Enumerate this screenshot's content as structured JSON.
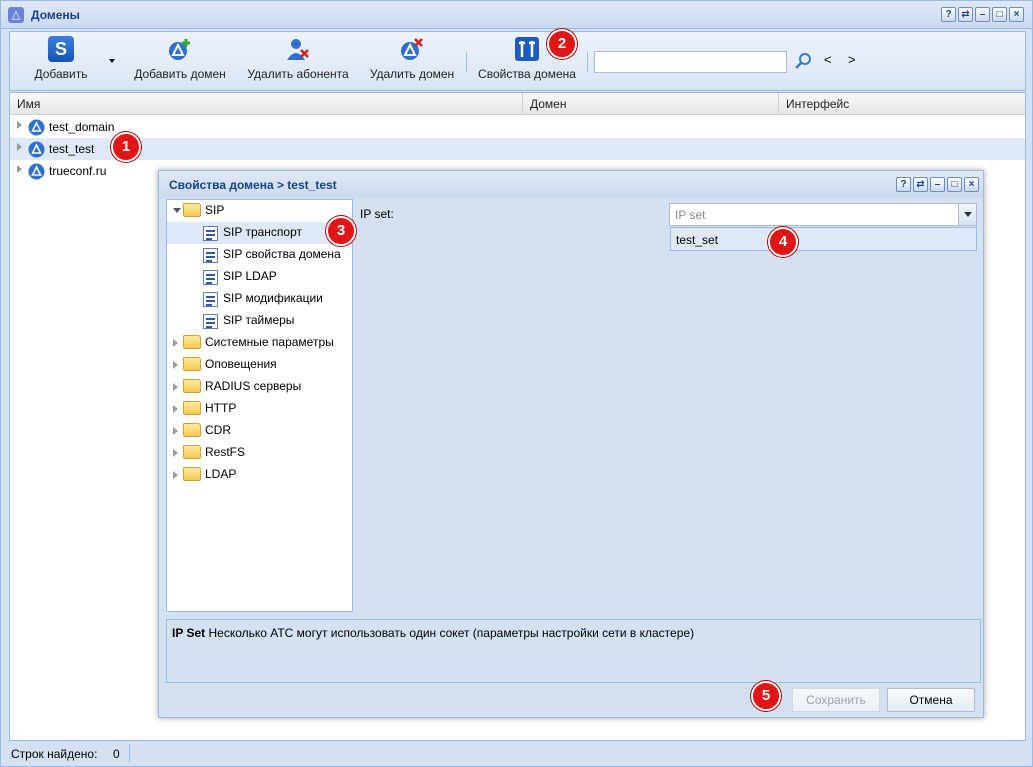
{
  "window": {
    "title": "Домены"
  },
  "toolbar": {
    "add": "Добавить",
    "add_domain": "Добавить домен",
    "remove_subscriber": "Удалить абонента",
    "remove_domain": "Удалить домен",
    "domain_props": "Свойства домена",
    "search_value": "",
    "prev": "<",
    "next": ">"
  },
  "grid": {
    "columns": [
      "Имя",
      "Домен",
      "Интерфейс"
    ],
    "rows": [
      {
        "name": "test_domain"
      },
      {
        "name": "test_test"
      },
      {
        "name": "trueconf.ru"
      }
    ]
  },
  "status": {
    "label": "Строк найдено:",
    "count": "0"
  },
  "dialog": {
    "title": "Свойства домена > test_test",
    "tree": {
      "sip": "SIP",
      "sip_transport": "SIP транспорт",
      "sip_domain_props": "SIP свойства домена",
      "sip_ldap": "SIP LDAP",
      "sip_mods": "SIP модификации",
      "sip_timers": "SIP таймеры",
      "system_params": "Системные параметры",
      "notifications": "Оповещения",
      "radius": "RADIUS серверы",
      "http": "HTTP",
      "cdr": "CDR",
      "restfs": "RestFS",
      "ldap": "LDAP"
    },
    "form": {
      "ip_set_label": "IP set:",
      "ip_set_placeholder": "IP set",
      "option": "test_set"
    },
    "help": {
      "term": "IP Set",
      "text": " Несколько АТС могут использовать один сокет (параметры настройки сети в кластере)"
    },
    "buttons": {
      "save": "Сохранить",
      "cancel": "Отмена"
    }
  },
  "badges": [
    "1",
    "2",
    "3",
    "4",
    "5"
  ]
}
